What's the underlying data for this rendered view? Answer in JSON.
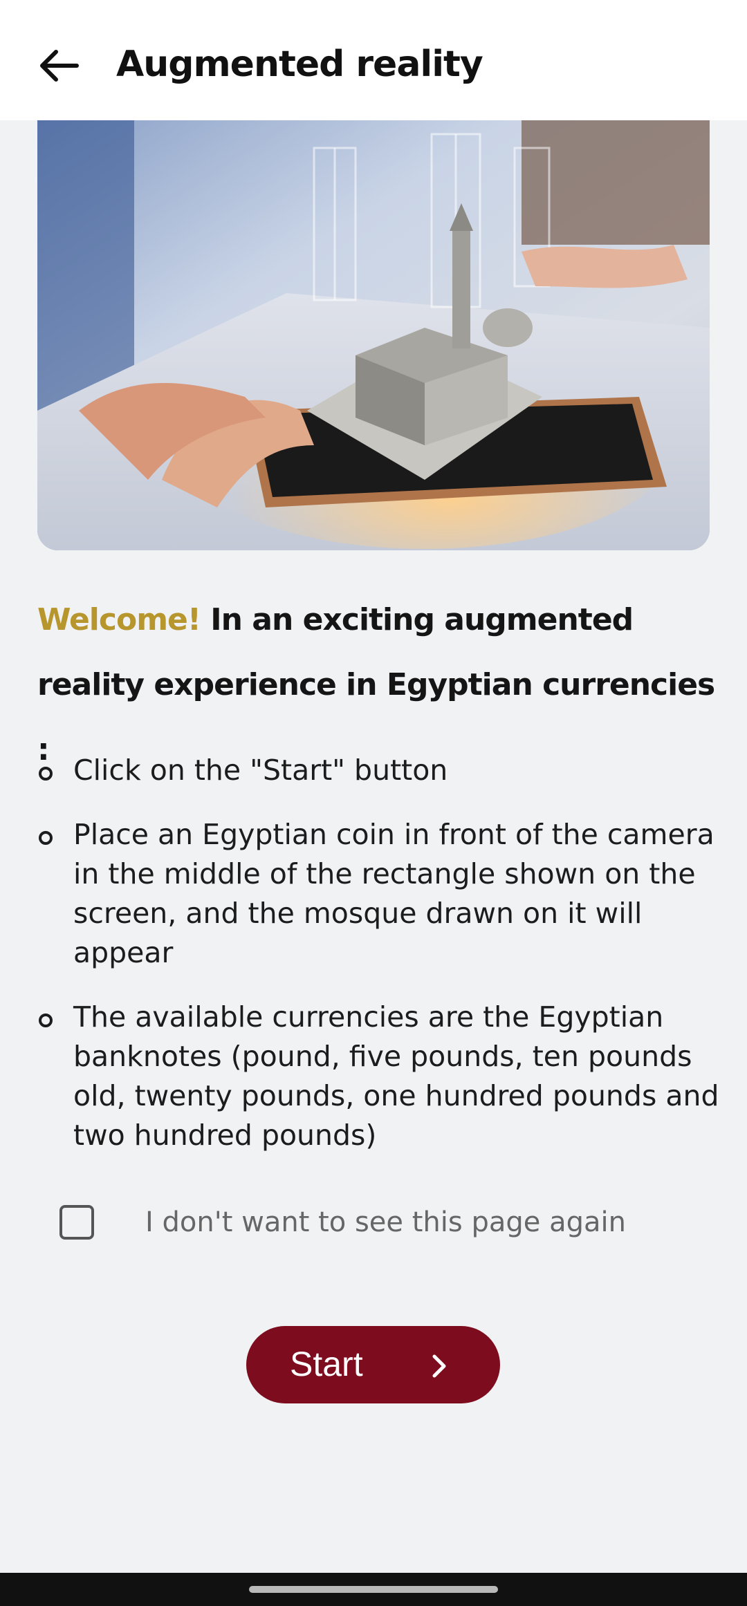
{
  "header": {
    "title": "Augmented reality",
    "back_icon": "arrow-left-icon"
  },
  "hero": {
    "image_icon": "augmented-reality-mosque-illustration"
  },
  "intro": {
    "highlight": "Welcome!",
    "text": " In an exciting augmented reality experience in Egyptian currencies :"
  },
  "instructions": [
    "Click on the \"Start\" button",
    "Place an Egyptian coin in front of the camera in the middle of the rectangle shown on the screen, and the mosque drawn on it will appear",
    "The available currencies are the Egyptian banknotes (pound, five pounds, ten pounds old, twenty pounds, one hundred pounds and two hundred pounds)"
  ],
  "opt_out": {
    "label": "I don't want to see this page again",
    "checked": false
  },
  "start_button": {
    "label": "Start",
    "icon": "chevron-right-icon"
  },
  "colors": {
    "accent_gold": "#b8962e",
    "brand_maroon": "#7d0c1e",
    "background": "#f1f2f4"
  }
}
